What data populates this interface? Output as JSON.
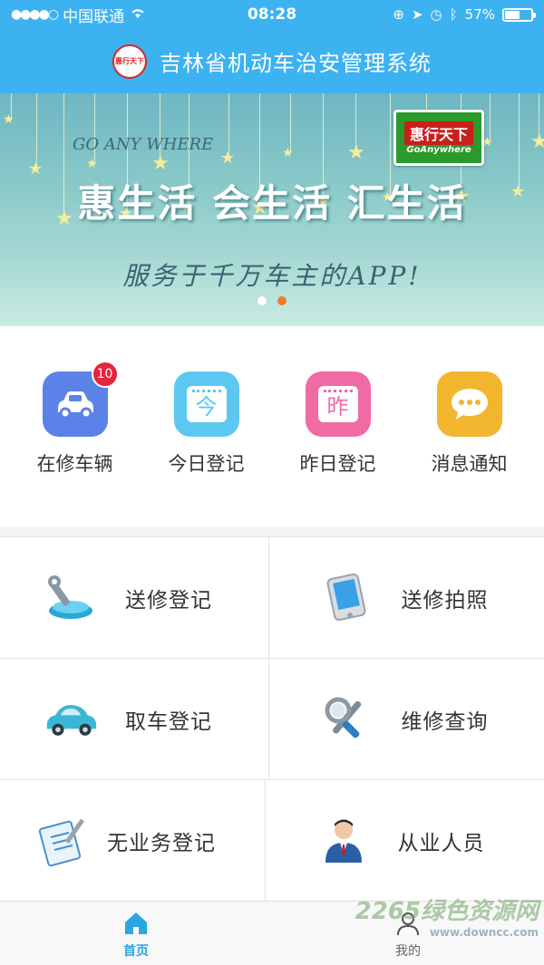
{
  "status_bar": {
    "carrier": "中国联通",
    "time": "08:28",
    "battery": "57%",
    "battery_level": 0.57
  },
  "header": {
    "title": "吉林省机动车治安管理系统",
    "logo_text": "惠行天下"
  },
  "banner": {
    "tagline_en": "GO ANY WHERE",
    "slogan": "惠生活 会生活 汇生活",
    "subtitle": "服务于千万车主的APP!",
    "badge_top": "惠行天下",
    "badge_bottom": "GoAnywhere",
    "page_count": 2,
    "active_page": 2
  },
  "quick_actions": [
    {
      "label": "在修车辆",
      "badge": "10",
      "icon": "car-icon",
      "color": "#5b82e6"
    },
    {
      "label": "今日登记",
      "icon_text": "今",
      "icon": "calendar-today-icon",
      "color": "#5cc8f2"
    },
    {
      "label": "昨日登记",
      "icon_text": "昨",
      "icon": "calendar-yesterday-icon",
      "color": "#f06aa4"
    },
    {
      "label": "消息通知",
      "icon": "chat-bubble-icon",
      "color": "#f2b52e"
    }
  ],
  "grid": [
    {
      "label": "送修登记",
      "icon": "wrench-car-icon"
    },
    {
      "label": "送修拍照",
      "icon": "tablet-icon"
    },
    {
      "label": "取车登记",
      "icon": "car-icon"
    },
    {
      "label": "维修查询",
      "icon": "magnifier-wrench-icon"
    },
    {
      "label": "无业务登记",
      "icon": "clipboard-icon"
    },
    {
      "label": "从业人员",
      "icon": "person-icon"
    }
  ],
  "tabbar": {
    "home": "首页",
    "mine": "我的"
  },
  "watermark": {
    "text": "2265绿色资源网",
    "sub": "www.downcc.com"
  }
}
